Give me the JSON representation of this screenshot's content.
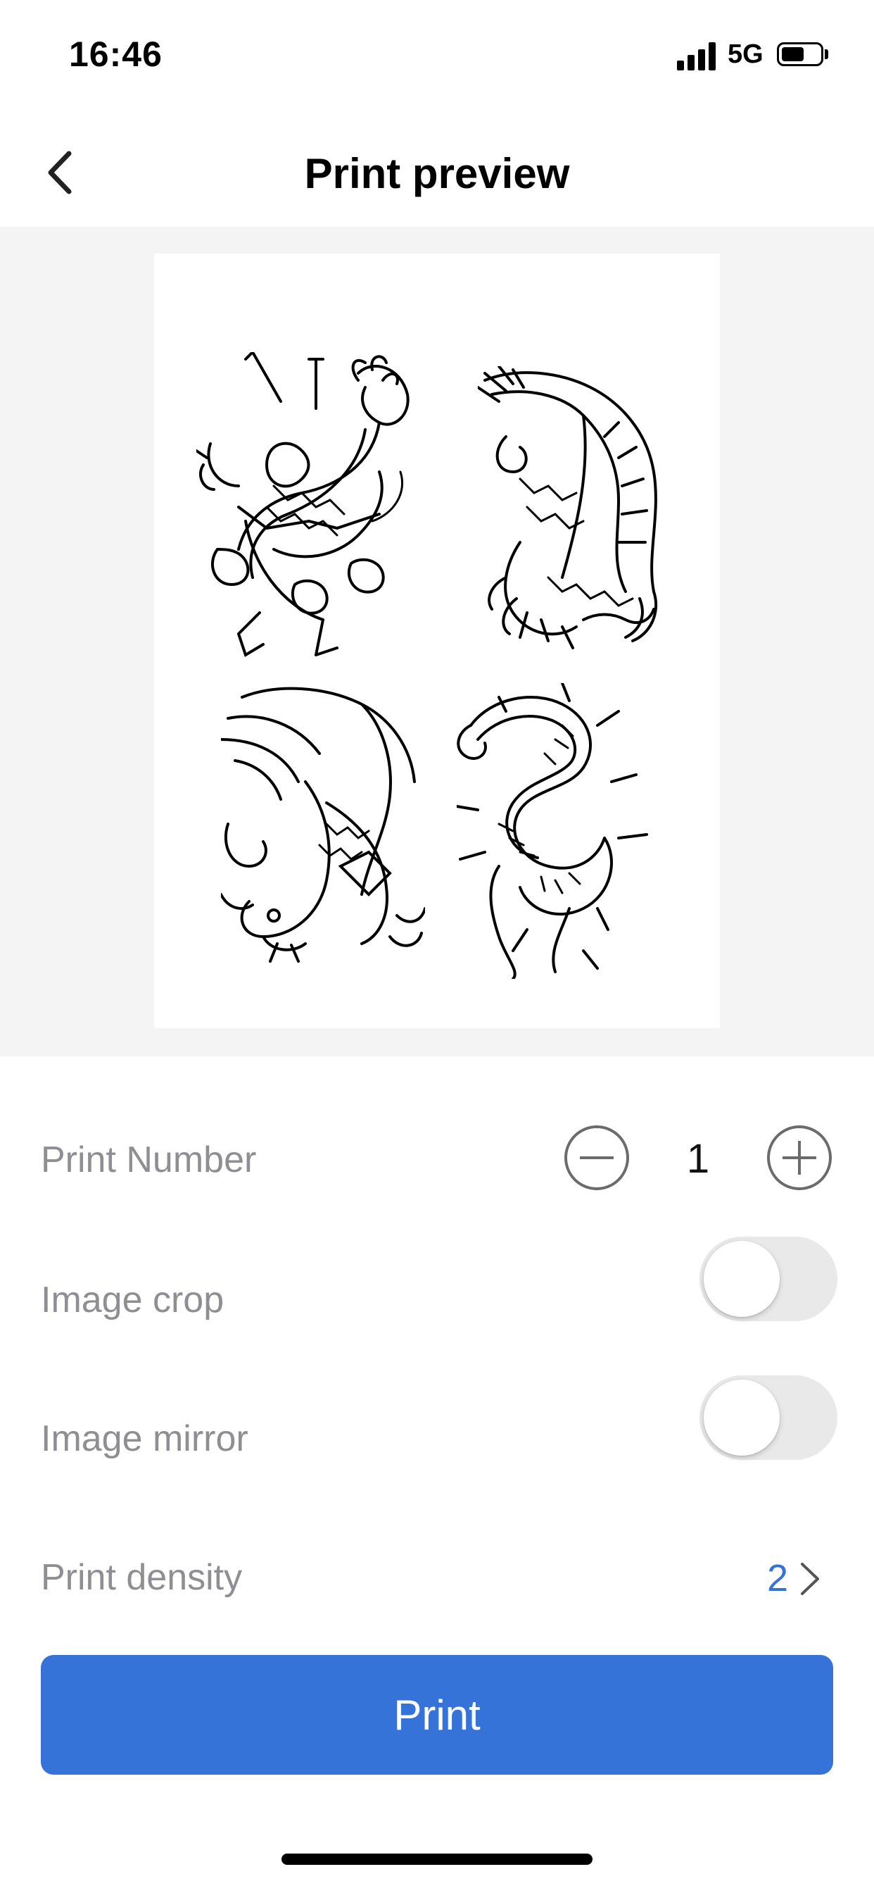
{
  "status_bar": {
    "time": "16:46",
    "network": "5G",
    "battery_level": 0.6
  },
  "nav": {
    "title": "Print preview",
    "back_icon": "chevron-left-icon"
  },
  "preview": {
    "images": [
      {
        "description_icon": "phoenix-tattoo-icon"
      },
      {
        "description_icon": "koi-dragon-tattoo-icon"
      },
      {
        "description_icon": "koi-fish-tattoo-icon"
      },
      {
        "description_icon": "snake-tattoo-icon"
      }
    ]
  },
  "settings": {
    "print_number": {
      "label": "Print Number",
      "value": "1",
      "minus_icon": "minus-circle-icon",
      "plus_icon": "plus-circle-icon"
    },
    "image_crop": {
      "label": "Image crop",
      "enabled": false
    },
    "image_mirror": {
      "label": "Image mirror",
      "enabled": false
    },
    "print_density": {
      "label": "Print density",
      "value": "2",
      "chevron_icon": "chevron-right-icon"
    }
  },
  "actions": {
    "print_label": "Print"
  },
  "colors": {
    "accent": "#3573d9",
    "label": "#8e8e93",
    "preview_bg": "#f4f4f4",
    "toggle_off": "#e9e9ea"
  }
}
